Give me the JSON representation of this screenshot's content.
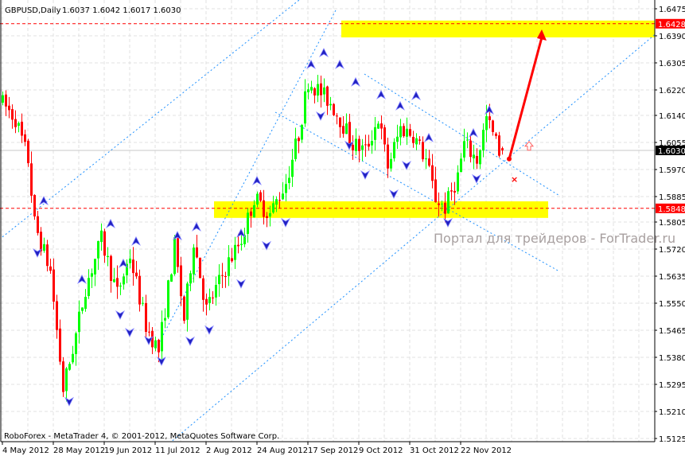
{
  "header": {
    "symbol_period": "GBPUSD,Daily",
    "ohlc": "1.6037 1.6042 1.6017 1.6030"
  },
  "footer": {
    "copyright": "RoboForex - MetaTrader 4, © 2001-2012, MetaQuotes Software Corp."
  },
  "watermark": "Портал для трейдеров - ForTrader.ru",
  "colors": {
    "bull": "#00ff00",
    "bear": "#ff0000",
    "zone": "#ffff00",
    "level": "#ff0000",
    "trend": "#1e90ff",
    "fractal": "#2020c0",
    "grid": "#e0e0e0"
  },
  "chart_data": {
    "type": "candlestick",
    "symbol": "GBPUSD",
    "timeframe": "Daily",
    "ylim": [
      1.5125,
      1.6475
    ],
    "y_ticks": [
      "1.6475",
      "1.6390",
      "1.6305",
      "1.6220",
      "1.6140",
      "1.6055",
      "1.5970",
      "1.5885",
      "1.5805",
      "1.5720",
      "1.5635",
      "1.5550",
      "1.5465",
      "1.5380",
      "1.5295",
      "1.5210",
      "1.5125"
    ],
    "x_ticks": [
      {
        "bar": 0,
        "label": "4 May 2012"
      },
      {
        "bar": 16,
        "label": "28 May 2012"
      },
      {
        "bar": 32,
        "label": "19 Jun 2012"
      },
      {
        "bar": 48,
        "label": "11 Jul 2012"
      },
      {
        "bar": 64,
        "label": "2 Aug 2012"
      },
      {
        "bar": 80,
        "label": "24 Aug 2012"
      },
      {
        "bar": 96,
        "label": "17 Sep 2012"
      },
      {
        "bar": 112,
        "label": "9 Oct 2012"
      },
      {
        "bar": 128,
        "label": "31 Oct 2012"
      },
      {
        "bar": 144,
        "label": "22 Nov 2012"
      }
    ],
    "bars_total": 158,
    "price_path": [
      [
        0,
        1.6185
      ],
      [
        1,
        1.6178
      ],
      [
        5,
        1.613
      ],
      [
        9,
        1.6
      ],
      [
        11,
        1.58
      ],
      [
        16,
        1.565
      ],
      [
        20,
        1.528
      ],
      [
        24,
        1.545
      ],
      [
        27,
        1.56
      ],
      [
        32,
        1.575
      ],
      [
        37,
        1.558
      ],
      [
        41,
        1.57
      ],
      [
        46,
        1.548
      ],
      [
        50,
        1.54
      ],
      [
        55,
        1.573
      ],
      [
        58,
        1.55
      ],
      [
        61,
        1.575
      ],
      [
        65,
        1.553
      ],
      [
        72,
        1.568
      ],
      [
        76,
        1.575
      ],
      [
        80,
        1.588
      ],
      [
        85,
        1.583
      ],
      [
        90,
        1.593
      ],
      [
        94,
        1.608
      ],
      [
        97,
        1.625
      ],
      [
        100,
        1.622
      ],
      [
        104,
        1.618
      ],
      [
        107,
        1.613
      ],
      [
        111,
        1.605
      ],
      [
        115,
        1.603
      ],
      [
        119,
        1.613
      ],
      [
        122,
        1.598
      ],
      [
        126,
        1.61
      ],
      [
        130,
        1.608
      ],
      [
        134,
        1.6
      ],
      [
        137,
        1.588
      ],
      [
        140,
        1.585
      ],
      [
        144,
        1.595
      ],
      [
        146,
        1.605
      ],
      [
        150,
        1.6
      ],
      [
        153,
        1.613
      ],
      [
        157,
        1.603
      ]
    ],
    "last_candle": {
      "open": 1.6037,
      "high": 1.6042,
      "low": 1.6017,
      "close": 1.603
    },
    "price_labels": [
      {
        "value": "1.6428",
        "price": 1.6428,
        "style": "level"
      },
      {
        "value": "1.6030",
        "price": 1.603,
        "style": "current"
      },
      {
        "value": "1.5848",
        "price": 1.5848,
        "style": "level"
      }
    ],
    "levels": [
      1.6428,
      1.5848
    ],
    "zones": [
      {
        "bar_from": 106.5,
        "bar_to": 205,
        "price_top": 1.6438,
        "price_bottom": 1.6385
      },
      {
        "bar_from": 66.5,
        "bar_to": 171.5,
        "price_top": 1.587,
        "price_bottom": 1.5818
      }
    ],
    "trendlines": [
      [
        [
          0,
          1.5758
        ],
        [
          124,
          1.6748
        ]
      ],
      [
        [
          52.5,
          1.511
        ],
        [
          205.75,
          1.64
        ]
      ],
      [
        [
          48.75,
          1.5417
        ],
        [
          105,
          1.6475
        ]
      ],
      [
        [
          85.75,
          1.615
        ],
        [
          175,
          1.565
        ]
      ],
      [
        [
          113.75,
          1.627
        ],
        [
          175,
          1.5888
        ]
      ]
    ],
    "forecast_arrow": {
      "from": [
        159.25,
        1.6003
      ],
      "to": [
        169.5,
        1.641
      ]
    },
    "stop_marker": [
      160.75,
      1.594
    ],
    "buy_marker": [
      165.5,
      1.6043
    ],
    "fractals_up": [
      [
        13,
        1.587
      ],
      [
        34,
        1.5798
      ],
      [
        25,
        1.5623
      ],
      [
        38,
        1.5673
      ],
      [
        42,
        1.5743
      ],
      [
        55,
        1.576
      ],
      [
        61,
        1.5788
      ],
      [
        75,
        1.5768
      ],
      [
        80,
        1.5933
      ],
      [
        97,
        1.6298
      ],
      [
        101,
        1.6335
      ],
      [
        106,
        1.6298
      ],
      [
        111,
        1.6243
      ],
      [
        119,
        1.6203
      ],
      [
        125,
        1.6168
      ],
      [
        130,
        1.62
      ],
      [
        134,
        1.6068
      ],
      [
        148,
        1.6083
      ],
      [
        153,
        1.6155
      ]
    ],
    "fractals_down": [
      [
        11,
        1.571
      ],
      [
        21,
        1.5243
      ],
      [
        37,
        1.5515
      ],
      [
        40,
        1.546
      ],
      [
        46,
        1.5435
      ],
      [
        50,
        1.537
      ],
      [
        59,
        1.5433
      ],
      [
        65,
        1.5468
      ],
      [
        75,
        1.5613
      ],
      [
        83,
        1.5733
      ],
      [
        89,
        1.5805
      ],
      [
        100,
        1.614
      ],
      [
        109,
        1.6048
      ],
      [
        114,
        1.5955
      ],
      [
        123,
        1.5895
      ],
      [
        127,
        1.5985
      ],
      [
        140,
        1.5805
      ],
      [
        149,
        1.5943
      ]
    ]
  }
}
